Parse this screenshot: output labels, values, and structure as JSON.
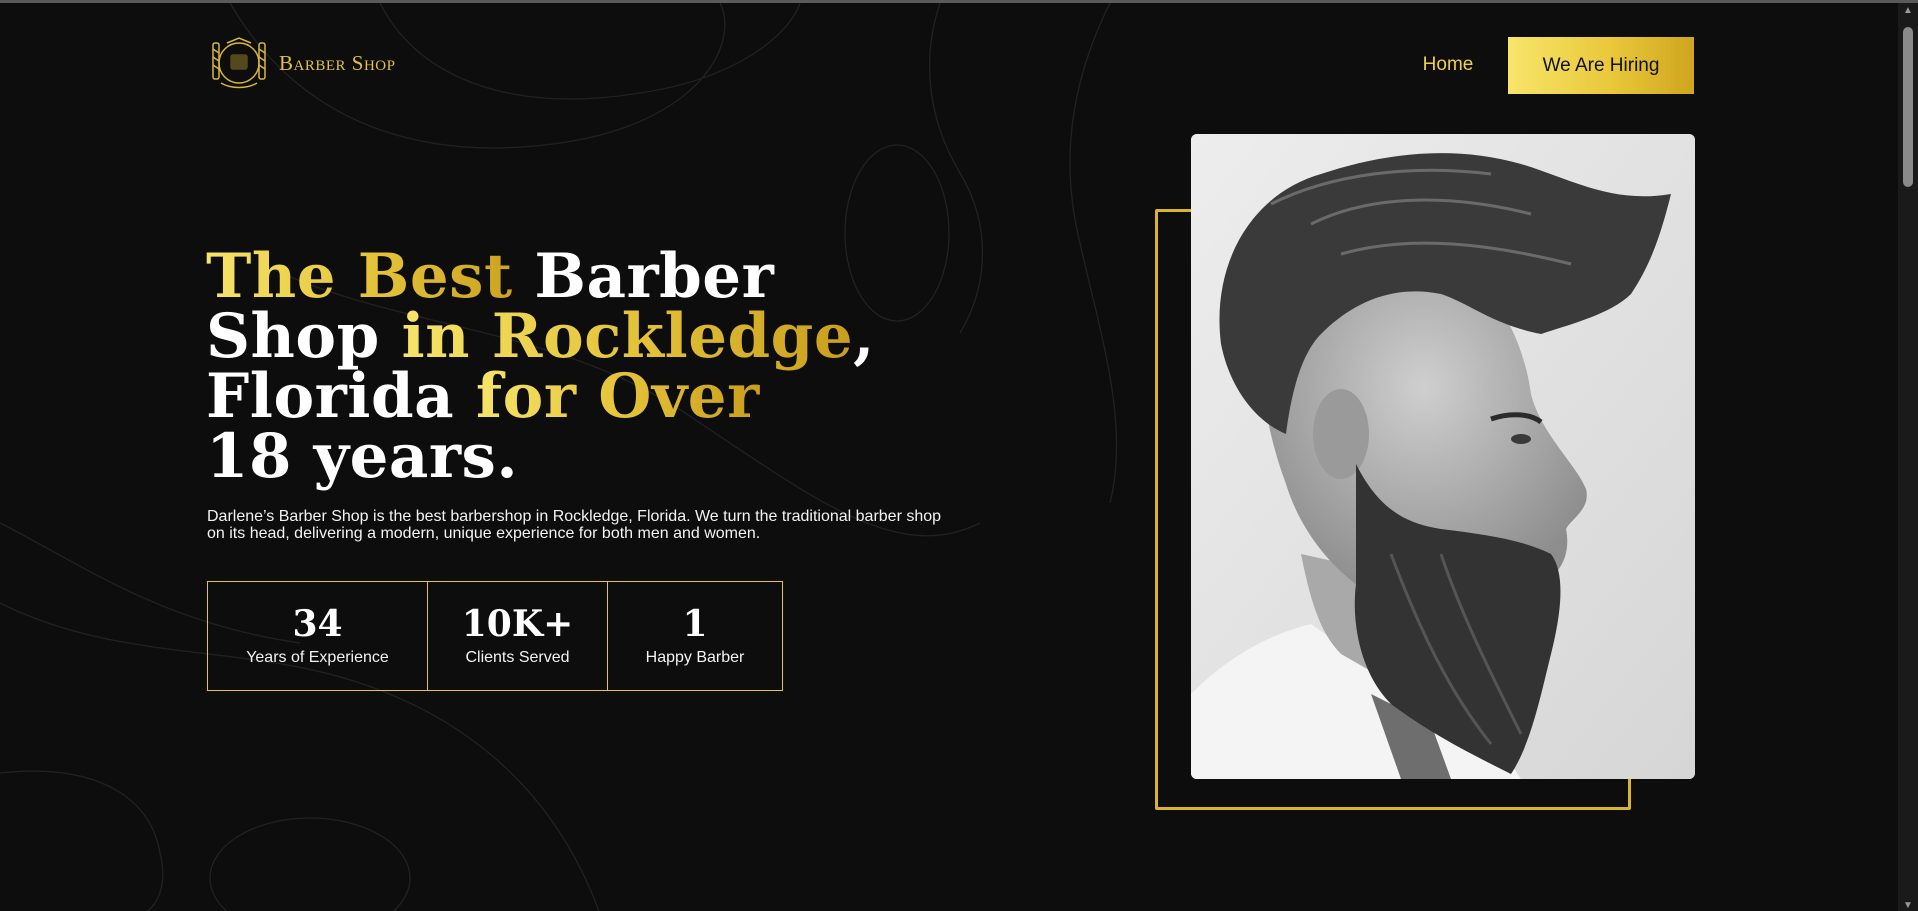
{
  "brand": {
    "name": "Barber Shop"
  },
  "nav": {
    "home_label": "Home",
    "hiring_label": "We Are Hiring"
  },
  "hero": {
    "title_line1_gold": "The Best ",
    "title_line1_white": "Barber",
    "title_line2_white": "Shop ",
    "title_line2_gold": "in Rockledge",
    "title_line2_comma": ",",
    "title_line3_white": "Florida ",
    "title_line3_gold": "for Over",
    "title_line4_white": "18 years.",
    "description": "Darlene’s Barber Shop is the best barbershop in Rockledge, Florida. We turn the traditional barber shop on its head, delivering a modern, unique experience for both men and women."
  },
  "stats": [
    {
      "value": "34",
      "label": "Years of Experience"
    },
    {
      "value": "10K+",
      "label": "Clients Served"
    },
    {
      "value": "1",
      "label": "Happy Barber"
    }
  ],
  "colors": {
    "accent_gold": "#e5c43a",
    "background": "#0d0d0e",
    "text": "#ffffff"
  },
  "icons": {
    "logo": "barber-pole-emblem-icon",
    "scroll_up": "triangle-up-icon",
    "scroll_down": "triangle-down-icon"
  }
}
